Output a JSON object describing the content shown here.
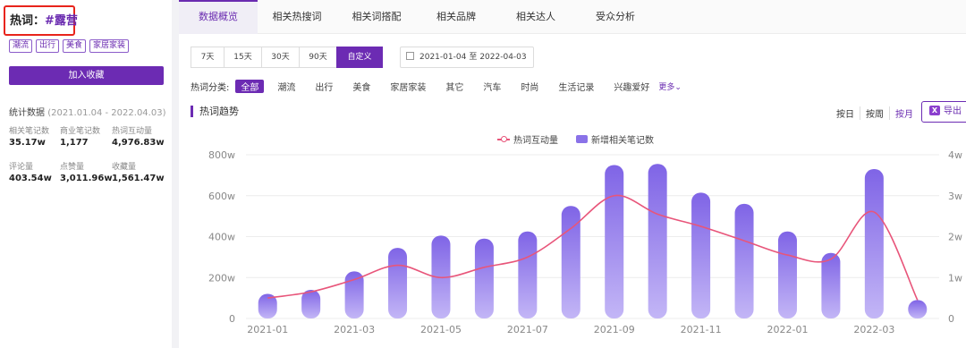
{
  "sidebar": {
    "hot_label": "热词：",
    "hot_keyword": "#露营",
    "tags": [
      "潮流",
      "出行",
      "美食",
      "家居家装"
    ],
    "fav_button": "加入收藏",
    "stats_title": "统计数据",
    "stats_range": "(2021.01.04 - 2022.04.03)",
    "stats": [
      {
        "label": "相关笔记数",
        "value": "35.17w"
      },
      {
        "label": "商业笔记数",
        "value": "1,177"
      },
      {
        "label": "热词互动量",
        "value": "4,976.83w"
      },
      {
        "label": "评论量",
        "value": "403.54w"
      },
      {
        "label": "点赞量",
        "value": "3,011.96w"
      },
      {
        "label": "收藏量",
        "value": "1,561.47w"
      }
    ]
  },
  "tabs": [
    "数据概览",
    "相关热搜词",
    "相关词搭配",
    "相关品牌",
    "相关达人",
    "受众分析"
  ],
  "active_tab": 0,
  "periods": [
    "7天",
    "15天",
    "30天",
    "90天",
    "自定义"
  ],
  "active_period": 4,
  "date_range": {
    "start": "2021-01-04",
    "sep": "至",
    "end": "2022-04-03"
  },
  "categories_label": "热词分类:",
  "categories": [
    "全部",
    "潮流",
    "出行",
    "美食",
    "家居家装",
    "其它",
    "汽车",
    "时尚",
    "生活记录",
    "兴趣爱好"
  ],
  "active_category": 0,
  "more_label": "更多",
  "section_title": "热词趋势",
  "granularity": [
    "按日",
    "按周",
    "按月"
  ],
  "active_granularity": 2,
  "export_label": "导出",
  "colors": {
    "accent": "#6c2bb3",
    "bar": "#8a72e8",
    "line": "#e8557a"
  },
  "chart_data": {
    "type": "bar",
    "legend": [
      "热词互动量",
      "新增相关笔记数"
    ],
    "categories": [
      "2021-01",
      "2021-02",
      "2021-03",
      "2021-04",
      "2021-05",
      "2021-06",
      "2021-07",
      "2021-08",
      "2021-09",
      "2021-10",
      "2021-11",
      "2021-12",
      "2022-01",
      "2022-02",
      "2022-03",
      "2022-04"
    ],
    "x_tick_labels": [
      "2021-01",
      "2021-03",
      "2021-05",
      "2021-07",
      "2021-09",
      "2021-11",
      "2022-01",
      "2022-03"
    ],
    "series": [
      {
        "name": "新增相关笔记数",
        "type": "bar",
        "axis": "left",
        "values": [
          120,
          140,
          230,
          345,
          405,
          390,
          425,
          550,
          750,
          755,
          615,
          560,
          425,
          320,
          730,
          90
        ]
      },
      {
        "name": "热词互动量",
        "type": "line",
        "axis": "right",
        "values": [
          0.5,
          0.65,
          0.95,
          1.3,
          1.0,
          1.25,
          1.5,
          2.2,
          3.0,
          2.55,
          2.25,
          1.9,
          1.55,
          1.45,
          2.6,
          0.45
        ]
      }
    ],
    "y_left": {
      "ticks": [
        "0",
        "200w",
        "400w",
        "600w",
        "800w"
      ],
      "min": 0,
      "max": 800
    },
    "y_right": {
      "ticks": [
        "0",
        "1w",
        "2w",
        "3w",
        "4w"
      ],
      "min": 0,
      "max": 4
    },
    "legend_position": "top-center",
    "grid": true
  }
}
